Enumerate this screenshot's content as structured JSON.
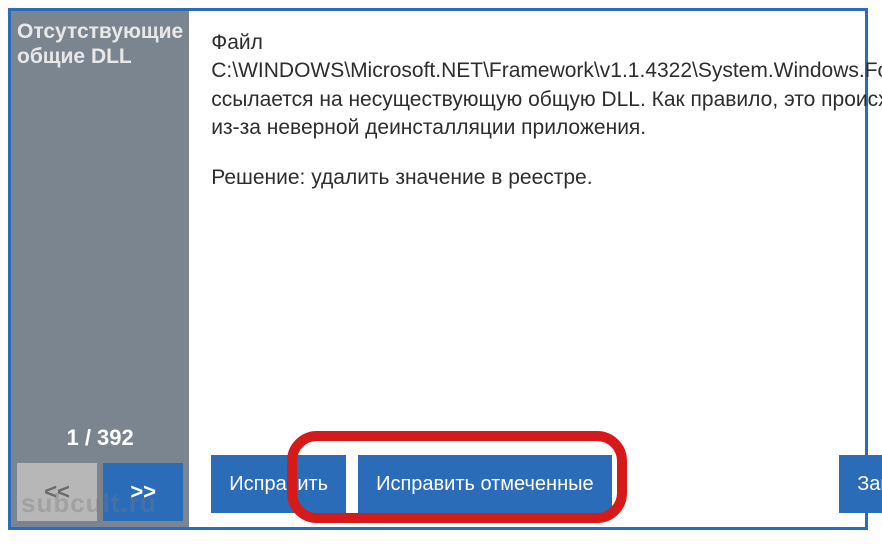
{
  "sidebar": {
    "title": "Отсутствующие общие DLL",
    "counter": "1 / 392",
    "prev_label": "<<",
    "next_label": ">>"
  },
  "content": {
    "description": "Файл C:\\WINDOWS\\Microsoft.NET\\Framework\\v1.1.4322\\System.Windows.Forms.tlb ссылается на несуществующую общую DLL. Как правило, это происходит из-за неверной деинсталляции приложения.",
    "solution": "Решение: удалить значение в реестре."
  },
  "buttons": {
    "fix": "Исправить",
    "fix_selected": "Исправить отмеченные",
    "close": "Закрыть"
  },
  "watermark": "subcult.ru"
}
